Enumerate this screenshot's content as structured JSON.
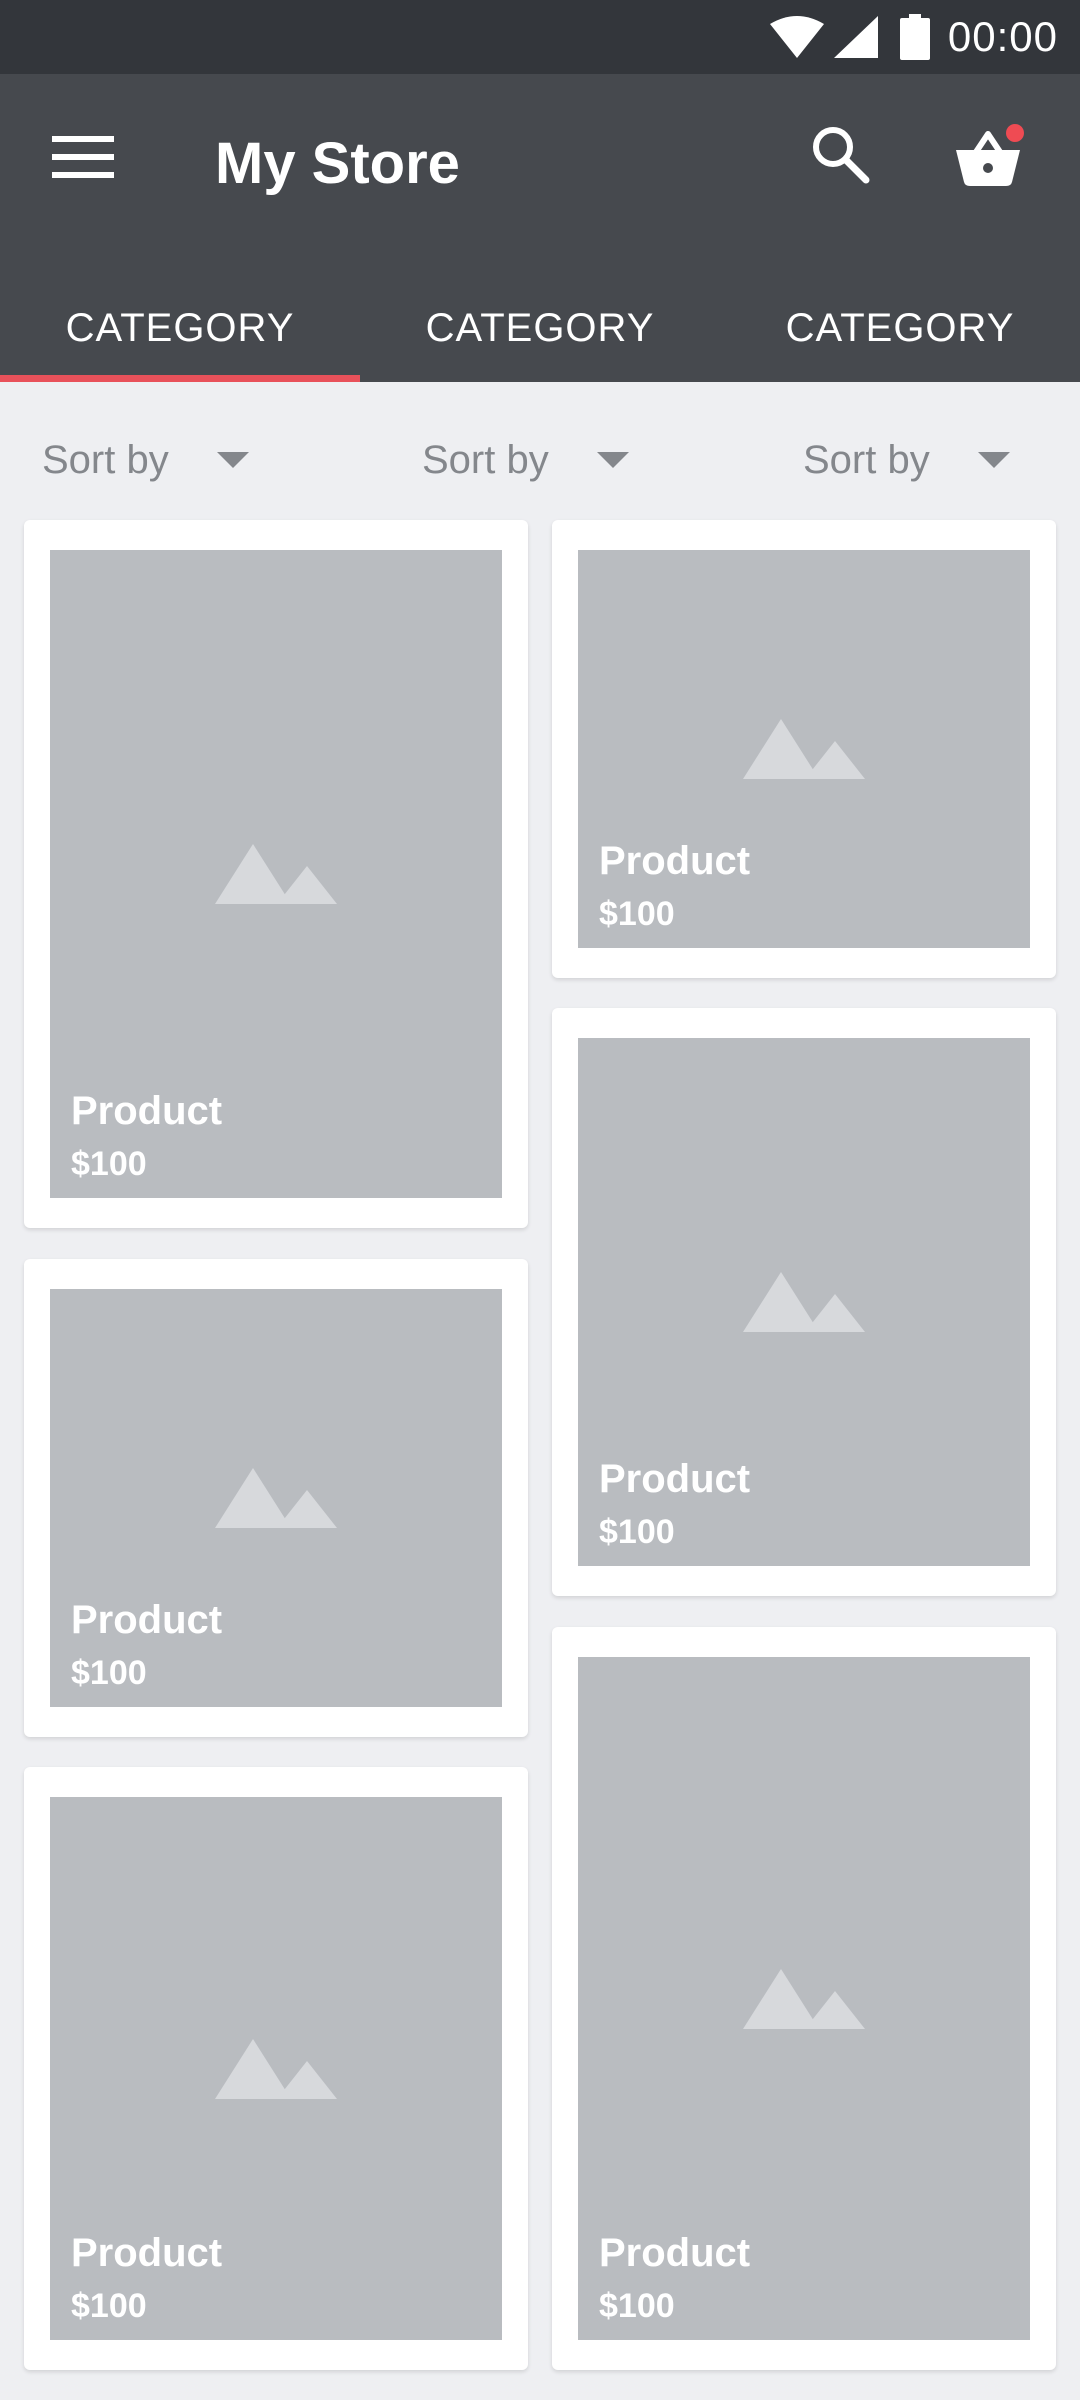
{
  "status_bar": {
    "time": "00:00"
  },
  "app_bar": {
    "title": "My Store",
    "menu_icon": "menu-icon",
    "search_icon": "search-icon",
    "cart_icon": "basket-icon",
    "cart_badge_color": "#ef4b53"
  },
  "tabs": [
    {
      "label": "CATEGORY",
      "active": true
    },
    {
      "label": "CATEGORY",
      "active": false
    },
    {
      "label": "CATEGORY",
      "active": false
    }
  ],
  "sort_options": [
    {
      "label": "Sort by"
    },
    {
      "label": "Sort by"
    },
    {
      "label": "Sort by"
    }
  ],
  "products": [
    {
      "name": "Product",
      "price": "$100"
    },
    {
      "name": "Product",
      "price": "$100"
    },
    {
      "name": "Product",
      "price": "$100"
    },
    {
      "name": "Product",
      "price": "$100"
    },
    {
      "name": "Product",
      "price": "$100"
    },
    {
      "name": "Product",
      "price": "$100"
    }
  ],
  "colors": {
    "app_bar": "#46494e",
    "status_bar": "#33363b",
    "tab_indicator": "#e8515a",
    "background": "#eeeff2",
    "image_placeholder": "#b9bcc0"
  }
}
